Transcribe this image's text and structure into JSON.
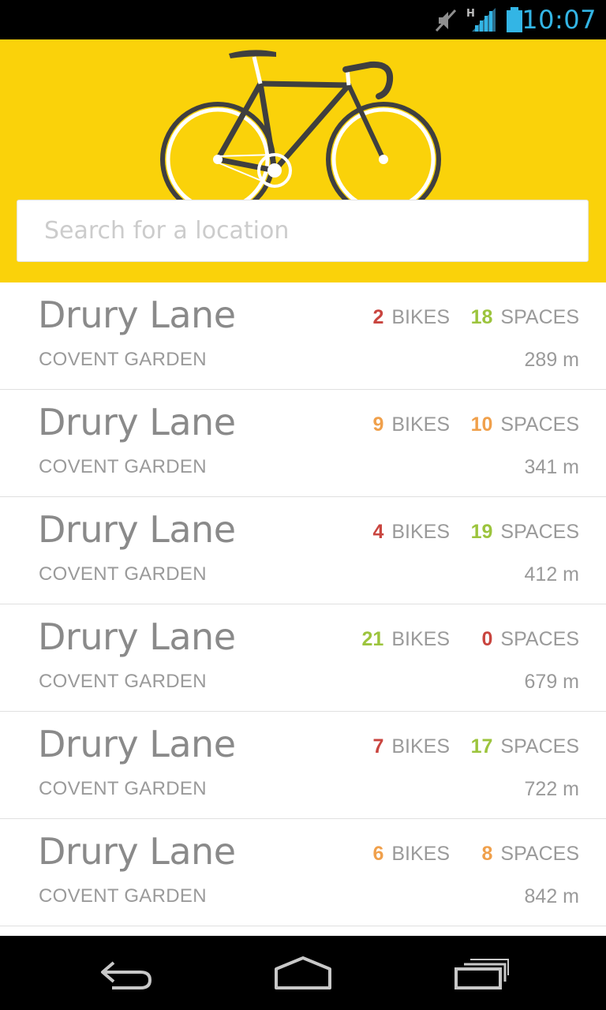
{
  "colors": {
    "brand": "#fad20a",
    "clock": "#33b5e5",
    "red": "#c9453f",
    "orange": "#f0a04b",
    "green": "#9cc43d",
    "text_gray": "#8a8a8a"
  },
  "status_bar": {
    "time": "10:07",
    "network_type": "H",
    "icons": [
      "mute-icon",
      "signal-icon",
      "battery-icon"
    ]
  },
  "header": {
    "illustration": "bicycle-icon",
    "search": {
      "value": "",
      "placeholder": "Search for a location"
    }
  },
  "labels": {
    "bikes": "BIKES",
    "spaces": "SPACES"
  },
  "stations": [
    {
      "name": "Drury Lane",
      "area": "COVENT GARDEN",
      "bikes": "2",
      "bikes_status": "red",
      "spaces": "18",
      "spaces_status": "green",
      "distance": "289 m"
    },
    {
      "name": "Drury Lane",
      "area": "COVENT GARDEN",
      "bikes": "9",
      "bikes_status": "orange",
      "spaces": "10",
      "spaces_status": "orange",
      "distance": "341 m"
    },
    {
      "name": "Drury Lane",
      "area": "COVENT GARDEN",
      "bikes": "4",
      "bikes_status": "red",
      "spaces": "19",
      "spaces_status": "green",
      "distance": "412 m"
    },
    {
      "name": "Drury Lane",
      "area": "COVENT GARDEN",
      "bikes": "21",
      "bikes_status": "green",
      "spaces": "0",
      "spaces_status": "red",
      "distance": "679 m"
    },
    {
      "name": "Drury Lane",
      "area": "COVENT GARDEN",
      "bikes": "7",
      "bikes_status": "red",
      "spaces": "17",
      "spaces_status": "green",
      "distance": "722 m"
    },
    {
      "name": "Drury Lane",
      "area": "COVENT GARDEN",
      "bikes": "6",
      "bikes_status": "orange",
      "spaces": "8",
      "spaces_status": "orange",
      "distance": "842 m"
    }
  ],
  "nav_bar": {
    "buttons": [
      "back-icon",
      "home-icon",
      "recent-apps-icon"
    ]
  }
}
